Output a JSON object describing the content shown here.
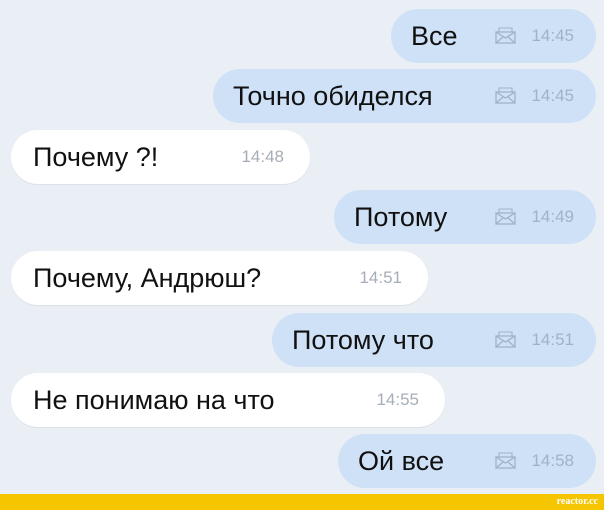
{
  "messages": [
    {
      "text": "Все",
      "time": "14:45",
      "direction": "out",
      "icon": "envelope-icon"
    },
    {
      "text": "Точно обиделся",
      "time": "14:45",
      "direction": "out",
      "icon": "envelope-icon"
    },
    {
      "text": "Почему ?!",
      "time": "14:48",
      "direction": "in"
    },
    {
      "text": "Потому",
      "time": "14:49",
      "direction": "out",
      "icon": "envelope-icon"
    },
    {
      "text": "Почему, Андрюш?",
      "time": "14:51",
      "direction": "in"
    },
    {
      "text": "Потому что",
      "time": "14:51",
      "direction": "out",
      "icon": "envelope-icon"
    },
    {
      "text": "Не понимаю на что",
      "time": "14:55",
      "direction": "in"
    },
    {
      "text": "Ой все",
      "time": "14:58",
      "direction": "out",
      "icon": "envelope-icon"
    }
  ],
  "footer": {
    "brand": "reactor.cc"
  },
  "colors": {
    "background": "#e9eff5",
    "outgoing_bubble": "#cfe1f6",
    "incoming_bubble": "#ffffff",
    "footer_bar": "#f5c500"
  }
}
